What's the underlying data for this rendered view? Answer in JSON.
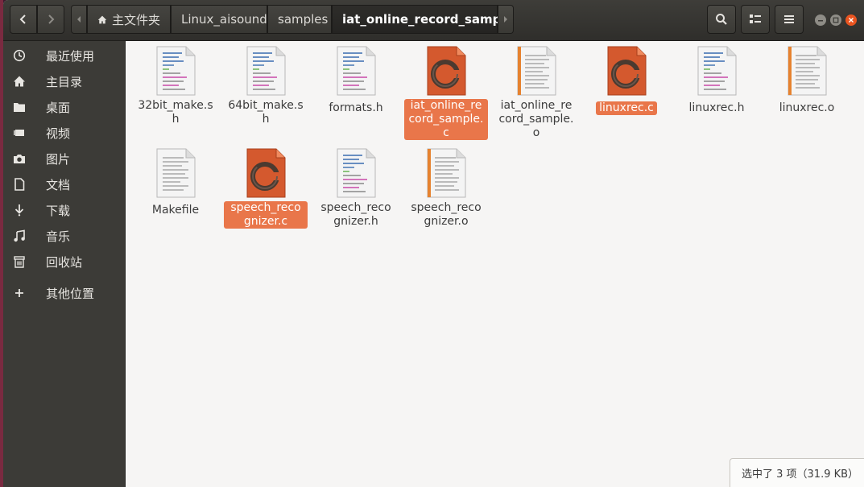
{
  "nav": {
    "back_icon": "chevron-left-icon",
    "forward_icon": "chevron-right-icon"
  },
  "breadcrumb": [
    {
      "label": "主文件夹",
      "icon": "home-icon"
    },
    {
      "label": "Linux_aisound"
    },
    {
      "label": "samples"
    },
    {
      "label": "iat_online_record_sample"
    }
  ],
  "toolbar": {
    "search_icon": "search-icon",
    "view_icon": "view-toggle-icon",
    "menu_icon": "hamburger-menu-icon"
  },
  "window_controls": {
    "colors": {
      "minimize": "#8e8c86",
      "maximize": "#8e8c86",
      "close": "#e95420"
    }
  },
  "sidebar": {
    "items": [
      {
        "label": "最近使用",
        "icon": "clock-icon"
      },
      {
        "label": "主目录",
        "icon": "home-icon"
      },
      {
        "label": "桌面",
        "icon": "folder-icon"
      },
      {
        "label": "视频",
        "icon": "video-icon"
      },
      {
        "label": "图片",
        "icon": "camera-icon"
      },
      {
        "label": "文档",
        "icon": "document-icon"
      },
      {
        "label": "下载",
        "icon": "download-icon"
      },
      {
        "label": "音乐",
        "icon": "music-icon"
      },
      {
        "label": "回收站",
        "icon": "trash-icon"
      },
      {
        "label": "其他位置",
        "icon": "plus-icon"
      }
    ]
  },
  "files": [
    {
      "label": "32bit_make.sh",
      "type": "script",
      "selected": false
    },
    {
      "label": "64bit_make.sh",
      "type": "script",
      "selected": false
    },
    {
      "label": "formats.h",
      "type": "header",
      "selected": false
    },
    {
      "label": "iat_online_record_sample.c",
      "type": "c-source",
      "selected": true
    },
    {
      "label": "iat_online_record_sample.o",
      "type": "object",
      "selected": false
    },
    {
      "label": "linuxrec.c",
      "type": "c-source",
      "selected": true
    },
    {
      "label": "linuxrec.h",
      "type": "header",
      "selected": false
    },
    {
      "label": "linuxrec.o",
      "type": "object",
      "selected": false
    },
    {
      "label": "Makefile",
      "type": "text",
      "selected": false
    },
    {
      "label": "speech_recognizer.c",
      "type": "c-source",
      "selected": true
    },
    {
      "label": "speech_recognizer.h",
      "type": "header",
      "selected": false
    },
    {
      "label": "speech_recognizer.o",
      "type": "object",
      "selected": false
    }
  ],
  "status": {
    "text": "选中了 3 项（31.9 KB）"
  },
  "colors": {
    "accent": "#e9764a",
    "sidebar_bg": "#3c3b37",
    "header_bg": "#3a3935"
  }
}
